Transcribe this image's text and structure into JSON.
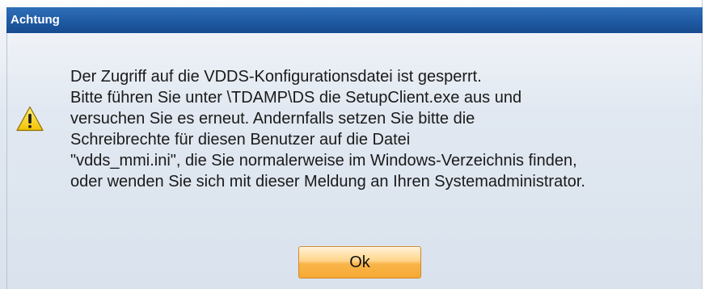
{
  "dialog": {
    "title": "Achtung",
    "icon": "warning-icon",
    "message_lines": [
      "Der Zugriff auf die VDDS-Konfigurationsdatei ist gesperrt.",
      "Bitte führen Sie unter \\TDAMP\\DS die SetupClient.exe aus und",
      "versuchen Sie es erneut. Andernfalls setzen Sie bitte die",
      "Schreibrechte für diesen Benutzer auf die Datei",
      "\"vdds_mmi.ini\", die Sie normalerweise im Windows-Verzeichnis finden,",
      "oder wenden Sie sich mit dieser Meldung an Ihren Systemadministrator."
    ],
    "ok_label": "Ok"
  },
  "colors": {
    "title_bar": "#1f5aa3",
    "title_text": "#ffffff",
    "button_fill": "#f9b54a",
    "warning_yellow": "#f7d21e"
  }
}
